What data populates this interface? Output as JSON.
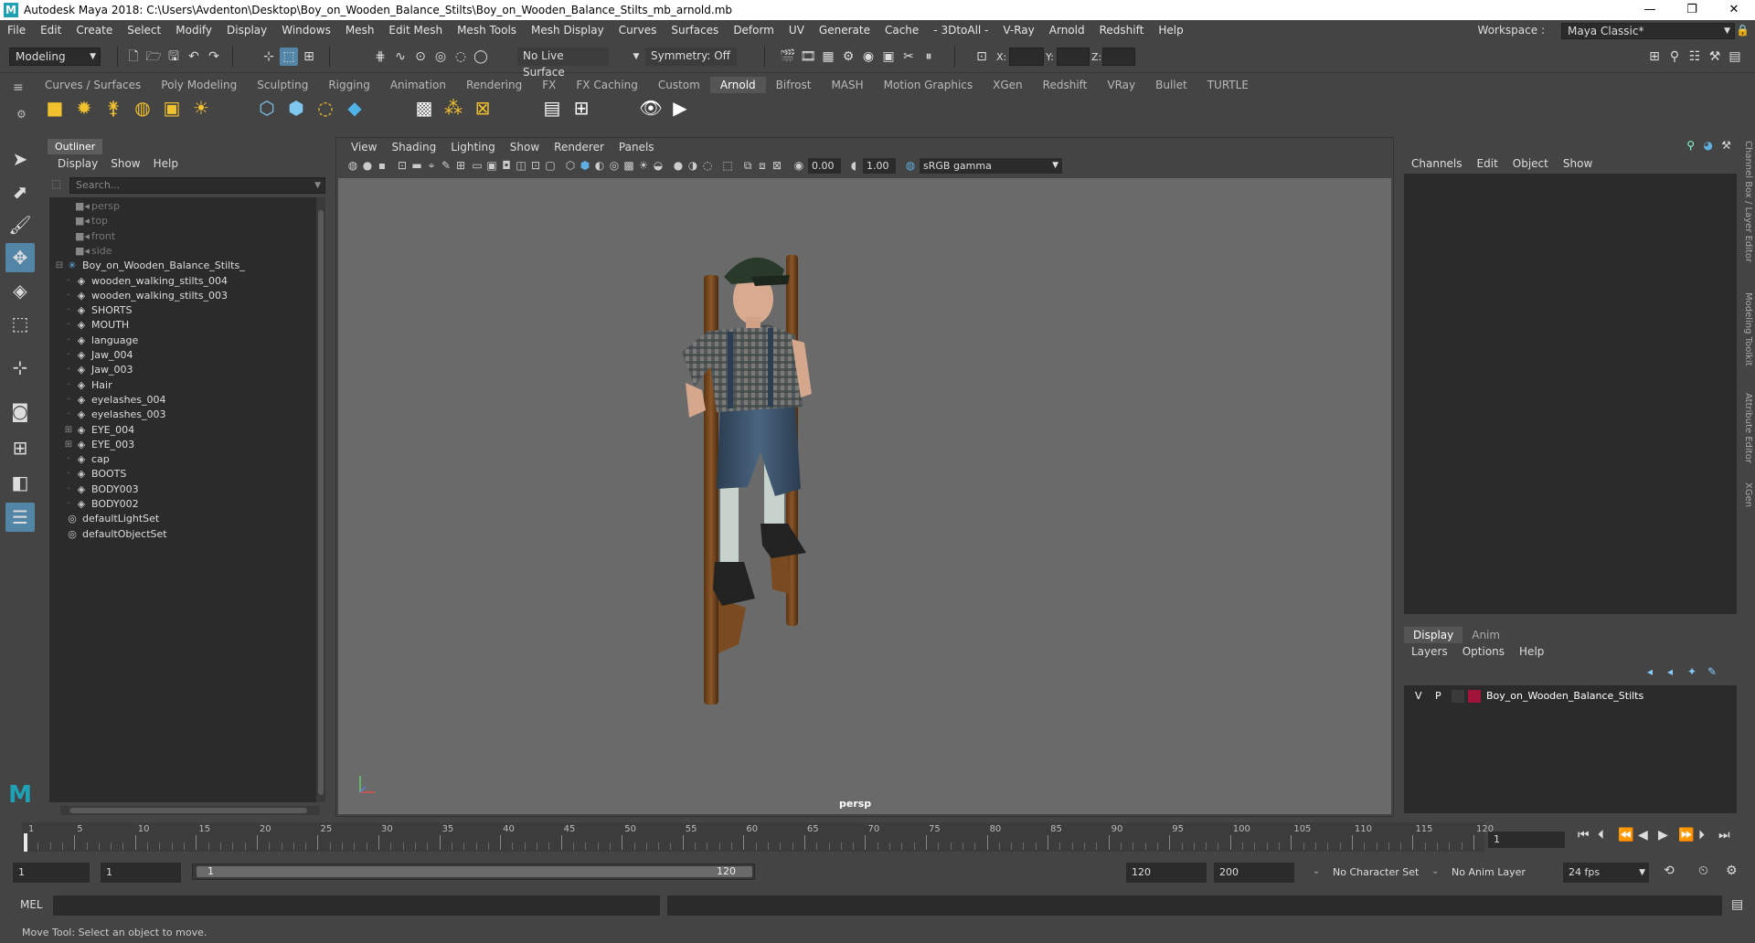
{
  "window": {
    "title": "Autodesk Maya 2018: C:\\Users\\Avdenton\\Desktop\\Boy_on_Wooden_Balance_Stilts\\Boy_on_Wooden_Balance_Stilts_mb_arnold.mb",
    "minimize": "—",
    "maximize": "❐",
    "close": "✕"
  },
  "menubar": [
    "File",
    "Edit",
    "Create",
    "Select",
    "Modify",
    "Display",
    "Windows",
    "Mesh",
    "Edit Mesh",
    "Mesh Tools",
    "Mesh Display",
    "Curves",
    "Surfaces",
    "Deform",
    "UV",
    "Generate",
    "Cache",
    "- 3DtoAll -",
    "V-Ray",
    "Arnold",
    "Redshift",
    "Help"
  ],
  "workspace": {
    "label": "Workspace :",
    "value": "Maya Classic*"
  },
  "statusline": {
    "mode": "Modeling",
    "live_surface": "No Live Surface",
    "symmetry": "Symmetry: Off",
    "x_label": "X:",
    "y_label": "Y:",
    "z_label": "Z:"
  },
  "shelf": {
    "tabs": [
      "Curves / Surfaces",
      "Poly Modeling",
      "Sculpting",
      "Rigging",
      "Animation",
      "Rendering",
      "FX",
      "FX Caching",
      "Custom",
      "Arnold",
      "Bifrost",
      "MASH",
      "Motion Graphics",
      "XGen",
      "Redshift",
      "VRay",
      "Bullet",
      "TURTLE"
    ],
    "active_tab": "Arnold"
  },
  "outliner": {
    "title": "Outliner",
    "menu": [
      "Display",
      "Show",
      "Help"
    ],
    "search_placeholder": "Search...",
    "items": [
      {
        "label": "persp",
        "type": "camera",
        "indent": 1,
        "dim": true
      },
      {
        "label": "top",
        "type": "camera",
        "indent": 1,
        "dim": true
      },
      {
        "label": "front",
        "type": "camera",
        "indent": 1,
        "dim": true
      },
      {
        "label": "side",
        "type": "camera",
        "indent": 1,
        "dim": true
      },
      {
        "label": "Boy_on_Wooden_Balance_Stilts_",
        "type": "group",
        "indent": 0,
        "expander": "⊟"
      },
      {
        "label": "wooden_walking_stilts_004",
        "type": "mesh",
        "indent": 1
      },
      {
        "label": "wooden_walking_stilts_003",
        "type": "mesh",
        "indent": 1
      },
      {
        "label": "SHORTS",
        "type": "mesh",
        "indent": 1
      },
      {
        "label": "MOUTH",
        "type": "mesh",
        "indent": 1
      },
      {
        "label": "language",
        "type": "mesh",
        "indent": 1
      },
      {
        "label": "Jaw_004",
        "type": "mesh",
        "indent": 1
      },
      {
        "label": "Jaw_003",
        "type": "mesh",
        "indent": 1
      },
      {
        "label": "Hair",
        "type": "mesh",
        "indent": 1
      },
      {
        "label": "eyelashes_004",
        "type": "mesh",
        "indent": 1
      },
      {
        "label": "eyelashes_003",
        "type": "mesh",
        "indent": 1
      },
      {
        "label": "EYE_004",
        "type": "mesh",
        "indent": 1,
        "expander": "⊞"
      },
      {
        "label": "EYE_003",
        "type": "mesh",
        "indent": 1,
        "expander": "⊞"
      },
      {
        "label": "cap",
        "type": "mesh",
        "indent": 1
      },
      {
        "label": "BOOTS",
        "type": "mesh",
        "indent": 1
      },
      {
        "label": "BODY003",
        "type": "mesh",
        "indent": 1
      },
      {
        "label": "BODY002",
        "type": "mesh",
        "indent": 1
      },
      {
        "label": "defaultLightSet",
        "type": "set",
        "indent": 0
      },
      {
        "label": "defaultObjectSet",
        "type": "set",
        "indent": 0
      }
    ]
  },
  "viewport": {
    "menu": [
      "View",
      "Shading",
      "Lighting",
      "Show",
      "Renderer",
      "Panels"
    ],
    "exposure": "0.00",
    "gamma": "1.00",
    "color_space": "sRGB gamma",
    "camera_label": "persp"
  },
  "channelbox": {
    "menu": [
      "Channels",
      "Edit",
      "Object",
      "Show"
    ]
  },
  "layer_editor": {
    "tabs": [
      "Display",
      "Anim"
    ],
    "active_tab": "Display",
    "menu": [
      "Layers",
      "Options",
      "Help"
    ],
    "layers": [
      {
        "v": "V",
        "p": "P",
        "color": "#a0143a",
        "name": "Boy_on_Wooden_Balance_Stilts"
      }
    ]
  },
  "side_tabs": [
    "Channel Box / Layer Editor",
    "Modeling Toolkit",
    "Attribute Editor",
    "XGen"
  ],
  "timeslider": {
    "ticks": [
      "1",
      "5",
      "10",
      "15",
      "20",
      "25",
      "30",
      "35",
      "40",
      "45",
      "50",
      "55",
      "60",
      "65",
      "70",
      "75",
      "80",
      "85",
      "90",
      "95",
      "100",
      "105",
      "110",
      "115",
      "120"
    ],
    "current_frame": "1"
  },
  "range": {
    "start": "1",
    "playback_start": "1",
    "slider_start": "1",
    "slider_end": "120",
    "playback_end": "120",
    "end": "200",
    "character_set": "No Character Set",
    "anim_layer": "No Anim Layer",
    "fps": "24 fps"
  },
  "cmdline": {
    "label": "MEL"
  },
  "help_line": "Move Tool: Select an object to move."
}
